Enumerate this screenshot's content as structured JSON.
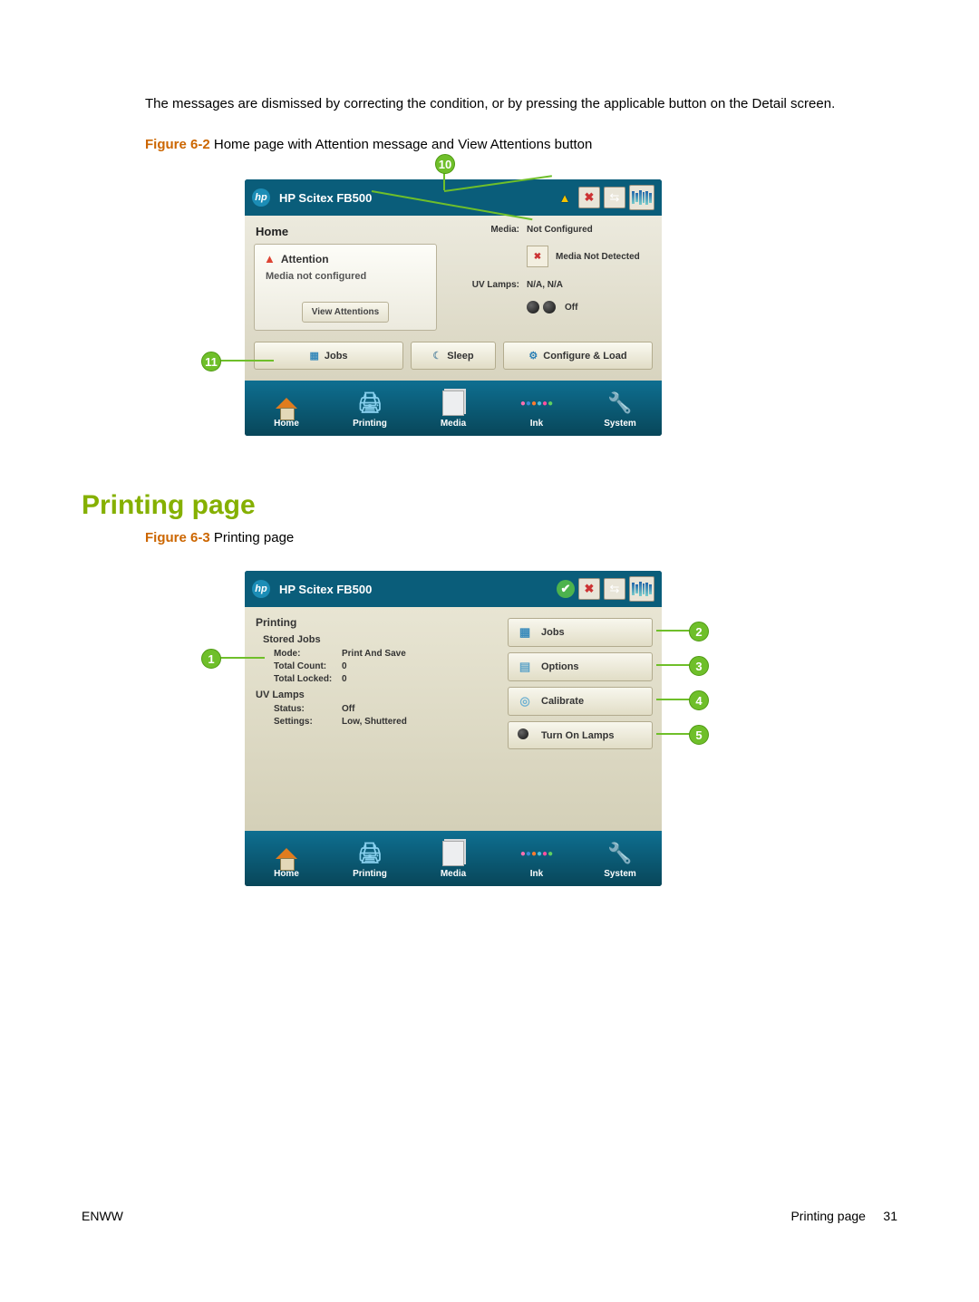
{
  "intro_text": "The messages are dismissed by correcting the condition, or by pressing the applicable button on the Detail screen.",
  "figure62": {
    "label_bold": "Figure 6-2",
    "label_rest": " Home page with Attention message and View Attentions button"
  },
  "section_heading": "Printing page",
  "figure63": {
    "label_bold": "Figure 6-3",
    "label_rest": " Printing page"
  },
  "panel": {
    "model": "HP Scitex FB500",
    "home": {
      "title": "Home",
      "attention_title": "Attention",
      "attention_msg": "Media not configured",
      "view_attentions": "View Attentions",
      "media_label": "Media:",
      "media_value": "Not Configured",
      "media_detect": "Media Not Detected",
      "uv_label": "UV Lamps:",
      "uv_value": "N/A, N/A",
      "uv_off": "Off",
      "btn_jobs": "Jobs",
      "btn_sleep": "Sleep",
      "btn_configure": "Configure & Load"
    },
    "printing": {
      "title": "Printing",
      "stored_jobs": "Stored Jobs",
      "mode_label": "Mode:",
      "mode_value": "Print And Save",
      "total_count_label": "Total Count:",
      "total_count_value": "0",
      "total_locked_label": "Total Locked:",
      "total_locked_value": "0",
      "uv_header": "UV Lamps",
      "status_label": "Status:",
      "status_value": "Off",
      "settings_label": "Settings:",
      "settings_value": "Low, Shuttered",
      "btn_jobs": "Jobs",
      "btn_options": "Options",
      "btn_calibrate": "Calibrate",
      "btn_lamps": "Turn On Lamps"
    },
    "nav": {
      "home": "Home",
      "printing": "Printing",
      "media": "Media",
      "ink": "Ink",
      "system": "System"
    }
  },
  "callouts": {
    "fig62_top": "10",
    "fig62_left": "11",
    "fig63_left": "1",
    "fig63_r1": "2",
    "fig63_r2": "3",
    "fig63_r3": "4",
    "fig63_r4": "5"
  },
  "footer": {
    "left": "ENWW",
    "right_label": "Printing page",
    "page_no": "31"
  }
}
